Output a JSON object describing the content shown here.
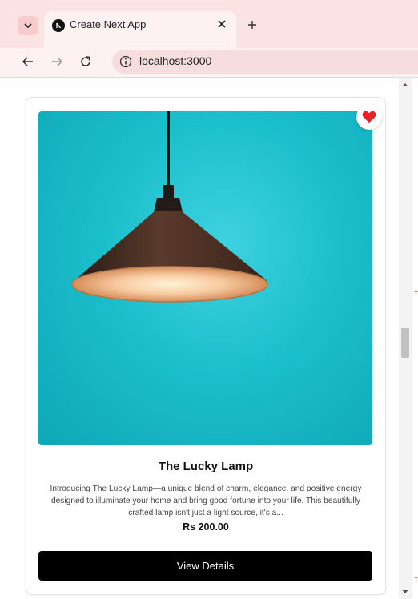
{
  "browser": {
    "tab": {
      "title": "Create Next App"
    },
    "address": {
      "url": "localhost:3000"
    }
  },
  "product": {
    "title": "The Lucky Lamp",
    "description": "Introducing The Lucky Lamp—a unique blend of charm, elegance, and positive energy designed to illuminate your home and bring good fortune into your life. This beautifully crafted lamp isn't just a light source, it's a...",
    "price": "Rs 200.00",
    "button_label": "View Details",
    "favorited": true
  },
  "colors": {
    "heart": "#e8202a",
    "image_background": "#1bbfcc",
    "button": "#000000",
    "tab_strip": "#fbe3e3"
  }
}
